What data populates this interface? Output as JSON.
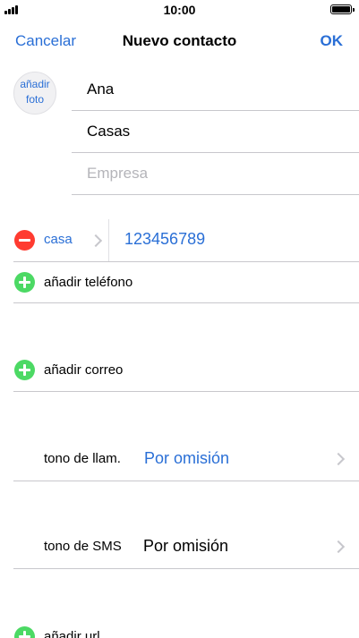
{
  "status_bar": {
    "time": "10:00"
  },
  "nav": {
    "cancel_label": "Cancelar",
    "title": "Nuevo contacto",
    "ok_label": "OK"
  },
  "photo": {
    "line1": "añadir",
    "line2": "foto"
  },
  "fields": {
    "first_name": "Ana",
    "last_name": "Casas",
    "company_placeholder": "Empresa"
  },
  "phone": {
    "label": "casa",
    "number": "123456789"
  },
  "rows": {
    "add_phone": "añadir teléfono",
    "add_email": "añadir correo",
    "add_url": "añadir url"
  },
  "ringtone": {
    "label": "tono de llam.",
    "value": "Por omisión"
  },
  "sms_tone": {
    "label": "tono de SMS",
    "value": "Por omisión"
  },
  "colors": {
    "accent": "#2a6fd6",
    "remove": "#ff3b30",
    "add": "#4cd964",
    "separator": "#c8c7cc"
  }
}
